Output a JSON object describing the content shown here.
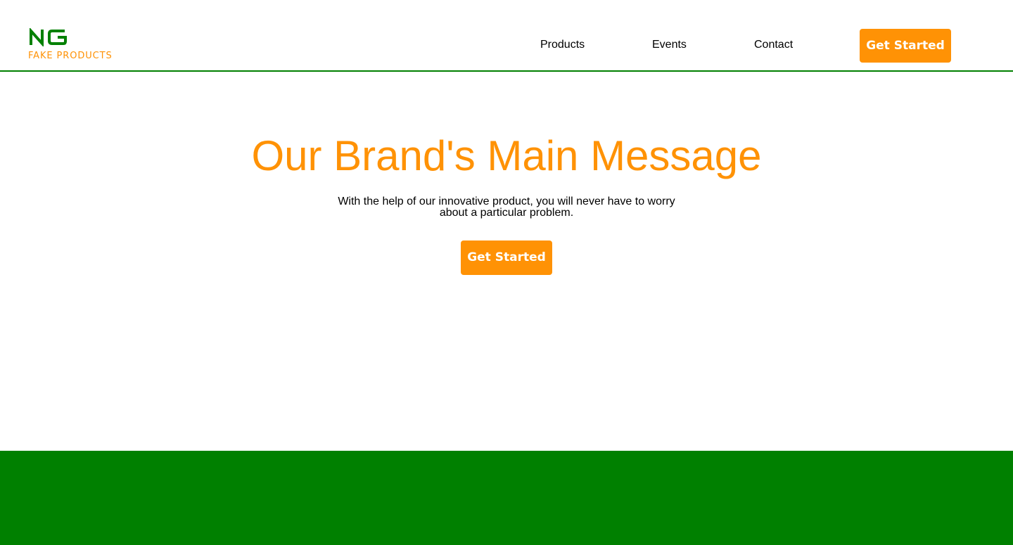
{
  "colors": {
    "brand_green": "#008000",
    "brand_orange": "#ff9205",
    "text": "#000000",
    "background": "#ffffff"
  },
  "header": {
    "logo": {
      "mark": "NG",
      "name": "FAKE PRODUCTS"
    },
    "nav": {
      "products": "Products",
      "events": "Events",
      "contact": "Contact"
    },
    "cta_label": "Get Started"
  },
  "hero": {
    "title": "Our Brand's Main Message",
    "subtitle": "With the help of our innovative product, you will never have to worry about a particular problem.",
    "cta_label": "Get Started"
  }
}
